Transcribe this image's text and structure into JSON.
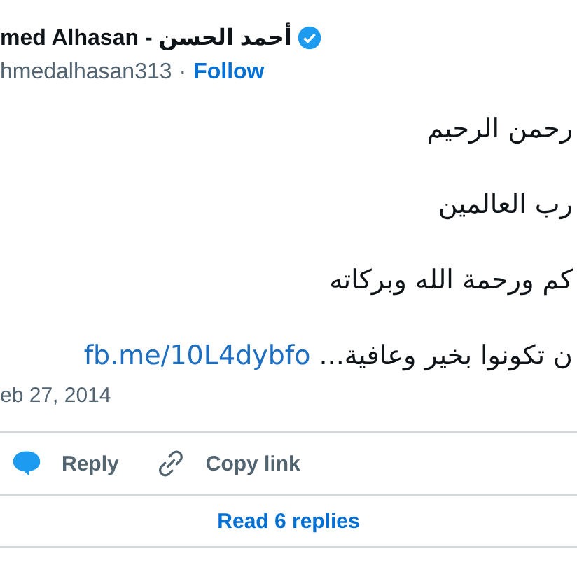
{
  "author": {
    "name": "med Alhasan - أحمد الحسن",
    "verified": true,
    "handle": "hmedalhasan313",
    "separator": "·",
    "follow": "Follow"
  },
  "tweet": {
    "lines": [
      "رحمن الرحيم",
      "رب العالمين",
      "كم ورحمة الله وبركاته",
      "ن تكونوا بخير وعافية..."
    ],
    "link": "fb.me/10L4dybfo",
    "date": "eb 27, 2014"
  },
  "actions": {
    "reply": "Reply",
    "copy_link": "Copy link"
  },
  "read_replies": "Read 6 replies"
}
